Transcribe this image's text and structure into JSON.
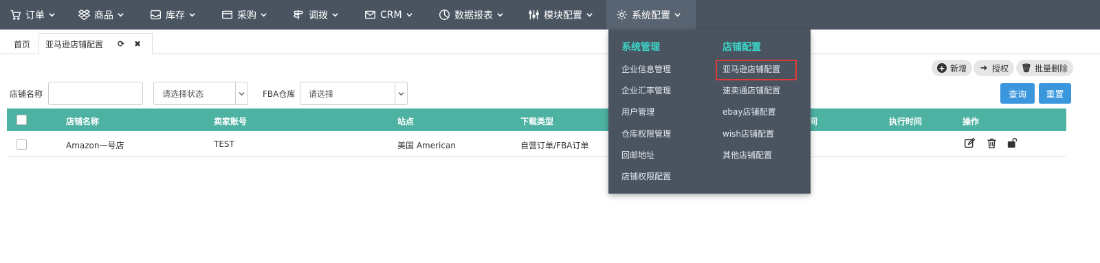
{
  "nav": {
    "items": [
      {
        "label": "订单",
        "icon": "cart-icon"
      },
      {
        "label": "商品",
        "icon": "dropbox-icon"
      },
      {
        "label": "库存",
        "icon": "inbox-icon"
      },
      {
        "label": "采购",
        "icon": "credit-card-icon"
      },
      {
        "label": "调拨",
        "icon": "signpost-icon"
      },
      {
        "label": "CRM",
        "icon": "envelope-icon"
      },
      {
        "label": "数据报表",
        "icon": "pie-chart-icon"
      },
      {
        "label": "模块配置",
        "icon": "sliders-icon"
      },
      {
        "label": "系统配置",
        "icon": "gear-icon"
      }
    ],
    "active_index": 8
  },
  "tabs": {
    "home": "首页",
    "active": "亚马逊店铺配置",
    "refresh_icon": "refresh-icon",
    "close_icon": "close-icon"
  },
  "actions": {
    "add": "新增",
    "authorize": "授权",
    "batch_delete": "批量删除"
  },
  "filters": {
    "shop_name_label": "店铺名称",
    "shop_name_value": "",
    "status_placeholder": "请选择状态",
    "fba_label": "FBA仓库",
    "fba_placeholder": "请选择",
    "search_button": "查询",
    "reset_button": "重置"
  },
  "table": {
    "columns": [
      "店铺名称",
      "卖家账号",
      "站点",
      "下载类型",
      "间",
      "执行时间",
      "操作"
    ],
    "rows": [
      {
        "shop": "Amazon一号店",
        "seller": "TEST",
        "site": "美国 American",
        "download_type": "自营订单/FBA订单"
      }
    ],
    "header_color": "#4db2a1"
  },
  "dropdown": {
    "col1_title": "系统管理",
    "col1_items": [
      "企业信息管理",
      "企业汇率管理",
      "用户管理",
      "仓库权限管理",
      "回邮地址",
      "店铺权限配置"
    ],
    "col2_title": "店铺配置",
    "col2_items": [
      "亚马逊店铺配置",
      "速卖通店铺配置",
      "ebay店铺配置",
      "wish店铺配置",
      "其他店铺配置"
    ],
    "highlight_index": 0,
    "title_color": "#3ad6c8"
  }
}
